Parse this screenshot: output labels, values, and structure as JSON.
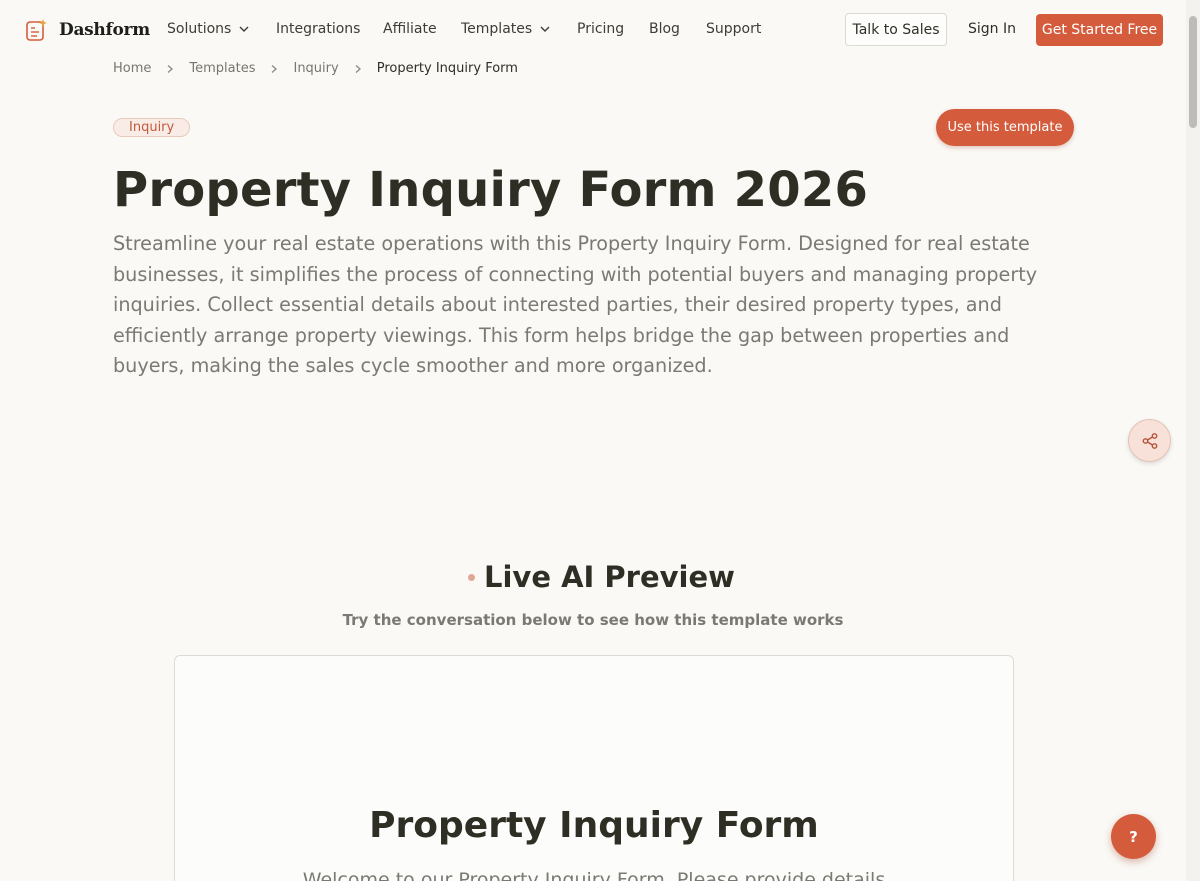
{
  "brand": {
    "name": "Dashform",
    "logo_icon": "form-sparkle-icon"
  },
  "nav": {
    "items": [
      {
        "label": "Solutions",
        "has_dropdown": true
      },
      {
        "label": "Integrations",
        "has_dropdown": false
      },
      {
        "label": "Affiliate",
        "has_dropdown": false
      },
      {
        "label": "Templates",
        "has_dropdown": true
      },
      {
        "label": "Pricing",
        "has_dropdown": false
      },
      {
        "label": "Blog",
        "has_dropdown": false
      },
      {
        "label": "Support",
        "has_dropdown": false
      }
    ],
    "talk_to_sales": "Talk to Sales",
    "sign_in": "Sign In",
    "get_started": "Get Started Free"
  },
  "breadcrumb": [
    "Home",
    "Templates",
    "Inquiry",
    "Property Inquiry Form"
  ],
  "hero": {
    "tag": "Inquiry",
    "use_template": "Use this template",
    "title": "Property Inquiry Form 2026",
    "description": "Streamline your real estate operations with this Property Inquiry Form. Designed for real estate businesses, it simplifies the process of connecting with potential buyers and managing property inquiries. Collect essential details about interested parties, their desired property types, and efficiently arrange property viewings. This form helps bridge the gap between properties and buyers, making the sales cycle smoother and more organized."
  },
  "share_icon": "share-icon",
  "live_preview": {
    "title": "Live AI Preview",
    "subtitle": "Try the conversation below to see how this template works",
    "form_title": "Property Inquiry Form",
    "form_intro": "Welcome to our Property Inquiry Form. Please provide details"
  },
  "help": {
    "label": "?"
  },
  "colors": {
    "accent": "#d45c3c",
    "background": "#faf9f6",
    "text": "#2e2e25",
    "muted": "#7a7972"
  }
}
